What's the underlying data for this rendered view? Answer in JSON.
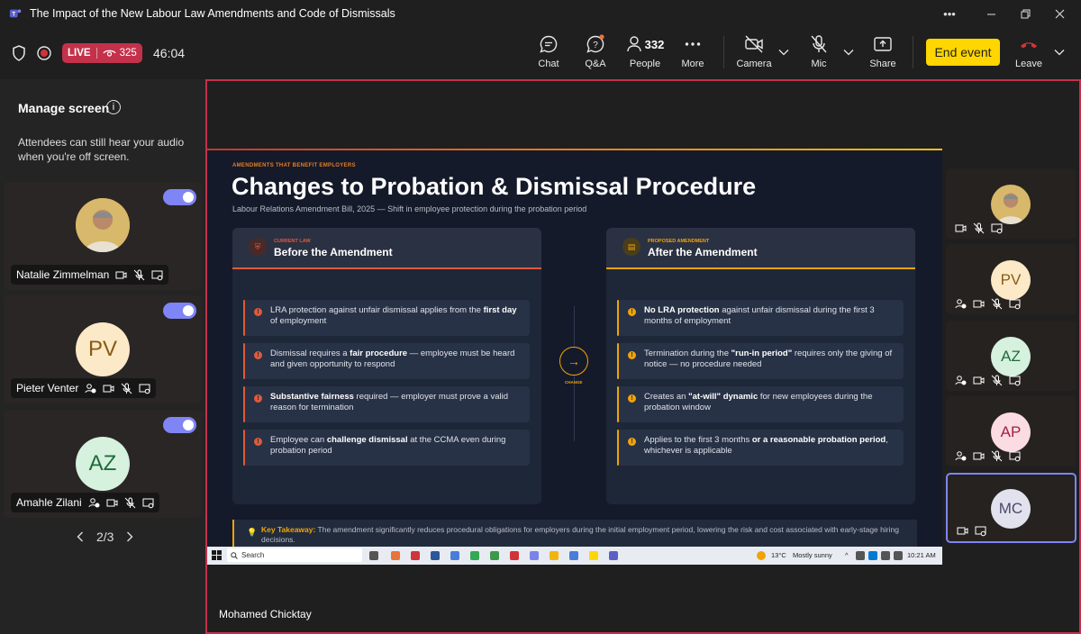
{
  "window": {
    "title": "The Impact of the New Labour Law Amendments and Code of Dismissals",
    "controls": [
      "more-icon",
      "minimize-icon",
      "restore-icon",
      "close-icon"
    ]
  },
  "toolbar": {
    "live_label": "LIVE",
    "viewer_count": "325",
    "timer": "46:04",
    "chat_label": "Chat",
    "qa_label": "Q&A",
    "people_label": "People",
    "people_count": "332",
    "more_label": "More",
    "camera_label": "Camera",
    "mic_label": "Mic",
    "share_label": "Share",
    "end_event_label": "End event",
    "leave_label": "Leave",
    "colors": {
      "live": "#c4314b",
      "end_event": "#ffd600",
      "leave": "#c4314b"
    }
  },
  "sidebar": {
    "title": "Manage screen",
    "description": "Attendees can still hear your audio when you're off screen.",
    "participants": [
      {
        "name": "Natalie Zimmelman",
        "initials": "",
        "avatar_color": "#c9a227"
      },
      {
        "name": "Pieter Venter",
        "initials": "PV",
        "avatar_color": "#fbe9c7",
        "text_color": "#8a5a14"
      },
      {
        "name": "Amahle Zilani",
        "initials": "AZ",
        "avatar_color": "#d6f1de",
        "text_color": "#1f6b3a"
      }
    ],
    "pager": "2/3"
  },
  "slide": {
    "kicker": "AMENDMENTS THAT BENEFIT EMPLOYERS",
    "title": "Changes to Probation & Dismissal Procedure",
    "subtitle": "Labour Relations Amendment Bill, 2025 — Shift in employee protection during the probation period",
    "left": {
      "kicker": "CURRENT LAW",
      "heading": "Before the Amendment",
      "accent": "#e05a3a",
      "items": [
        {
          "pre": "LRA protection against unfair dismissal applies from the ",
          "bold": "first day",
          "post": " of employment"
        },
        {
          "pre": "Dismissal requires a ",
          "bold": "fair procedure",
          "post": " — employee must be heard and given opportunity to respond"
        },
        {
          "pre": "",
          "bold": "Substantive fairness",
          "post": " required — employer must prove a valid reason for termination"
        },
        {
          "pre": "Employee can ",
          "bold": "challenge dismissal",
          "post": " at the CCMA even during probation period"
        }
      ]
    },
    "center_label": "CHANGE",
    "right": {
      "kicker": "PROPOSED AMENDMENT",
      "heading": "After the Amendment",
      "accent": "#f0a30a",
      "items": [
        {
          "pre": "",
          "bold": "No LRA protection",
          "post": " against unfair dismissal during the first 3 months of employment"
        },
        {
          "pre": "Termination during the ",
          "bold": "\"run-in period\"",
          "post": " requires only the giving of notice — no procedure needed"
        },
        {
          "pre": "Creates an ",
          "bold": "\"at-will\" dynamic",
          "post": " for new employees during the probation window"
        },
        {
          "pre": "Applies to the first 3 months ",
          "bold": "or a reasonable probation period",
          "post": ", whichever is applicable"
        }
      ]
    },
    "takeaway_label": "Key Takeaway:",
    "takeaway_text": " The amendment significantly reduces procedural obligations for employers during the initial employment period, lowering the risk and cost associated with early-stage hiring decisions."
  },
  "taskbar": {
    "search_placeholder": "Search",
    "weather": "13°C",
    "weather_desc": "Mostly sunny",
    "clock": "10:21 AM"
  },
  "right_strip": [
    {
      "initials": "",
      "avatar_color": "#c9a227",
      "photo": true
    },
    {
      "initials": "PV",
      "avatar_color": "#fbe9c7",
      "text_color": "#8a5a14"
    },
    {
      "initials": "AZ",
      "avatar_color": "#d6f1de",
      "text_color": "#1f6b3a"
    },
    {
      "initials": "AP",
      "avatar_color": "#fbdce2",
      "text_color": "#a3223f"
    },
    {
      "initials": "MC",
      "avatar_color": "#e2e2ee",
      "text_color": "#4a4a6a",
      "selected": true
    }
  ],
  "presenter_name": "Mohamed Chicktay"
}
